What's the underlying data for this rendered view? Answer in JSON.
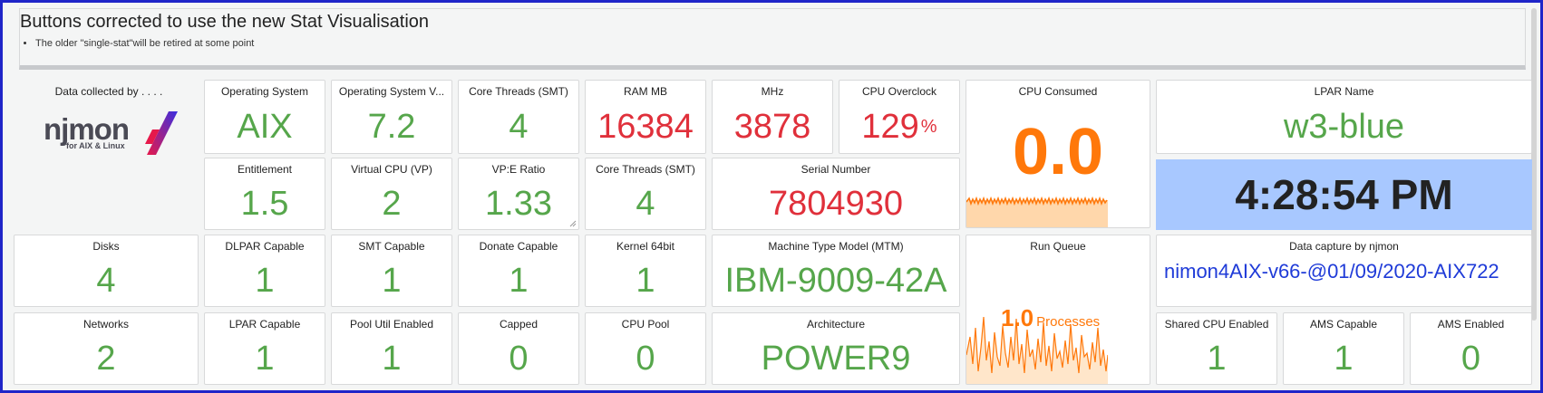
{
  "header": {
    "title": "Buttons corrected to use the new Stat Visualisation",
    "note": "The older \"single-stat\"will be retired at some point"
  },
  "logo_panel": {
    "title": "Data collected by . . . .",
    "logo_text": "njmon",
    "logo_sub": "for AIX & Linux"
  },
  "stats": {
    "operating_system": {
      "title": "Operating System",
      "value": "AIX"
    },
    "os_version": {
      "title": "Operating System V...",
      "value": "7.2"
    },
    "core_threads": {
      "title": "Core Threads (SMT)",
      "value": "4"
    },
    "ram_mb": {
      "title": "RAM MB",
      "value": "16384"
    },
    "mhz": {
      "title": "MHz",
      "value": "3878"
    },
    "cpu_overclock": {
      "title": "CPU Overclock",
      "value": "129",
      "unit": "%"
    },
    "cpu_consumed": {
      "title": "CPU Consumed",
      "value": "0.0"
    },
    "lpar_name": {
      "title": "LPAR Name",
      "value": "w3-blue",
      "clock": "4:28:54 PM"
    },
    "entitlement": {
      "title": "Entitlement",
      "value": "1.5"
    },
    "virtual_cpu": {
      "title": "Virtual CPU (VP)",
      "value": "2"
    },
    "vp_e_ratio": {
      "title": "VP:E Ratio",
      "value": "1.33"
    },
    "core_threads_2": {
      "title": "Core Threads (SMT)",
      "value": "4"
    },
    "serial_number": {
      "title": "Serial Number",
      "value": "7804930"
    },
    "disks": {
      "title": "Disks",
      "value": "4"
    },
    "dlpar_capable": {
      "title": "DLPAR Capable",
      "value": "1"
    },
    "smt_capable": {
      "title": "SMT Capable",
      "value": "1"
    },
    "donate_capable": {
      "title": "Donate Capable",
      "value": "1"
    },
    "kernel_64bit": {
      "title": "Kernel 64bit",
      "value": "1"
    },
    "mtm": {
      "title": "Machine Type Model (MTM)",
      "value": "IBM-9009-42A"
    },
    "run_queue": {
      "title": "Run Queue",
      "value": "1.0",
      "unit": "Processes"
    },
    "data_capture": {
      "title": "Data capture by njmon",
      "value": "nimon4AIX-v66-@01/09/2020-AIX722"
    },
    "networks": {
      "title": "Networks",
      "value": "2"
    },
    "lpar_capable": {
      "title": "LPAR Capable",
      "value": "1"
    },
    "pool_util": {
      "title": "Pool Util Enabled",
      "value": "1"
    },
    "capped": {
      "title": "Capped",
      "value": "0"
    },
    "cpu_pool": {
      "title": "CPU Pool",
      "value": "0"
    },
    "architecture": {
      "title": "Architecture",
      "value": "POWER9"
    },
    "shared_cpu": {
      "title": "Shared CPU Enabled",
      "value": "1"
    },
    "ams_capable": {
      "title": "AMS Capable",
      "value": "1"
    },
    "ams_enabled": {
      "title": "AMS Enabled",
      "value": "0"
    }
  },
  "colors": {
    "green": "#56a64b",
    "red": "#e0303b",
    "orange": "#ff780a",
    "link_blue": "#1f3bd8",
    "clock_bg": "#a8c8ff"
  }
}
